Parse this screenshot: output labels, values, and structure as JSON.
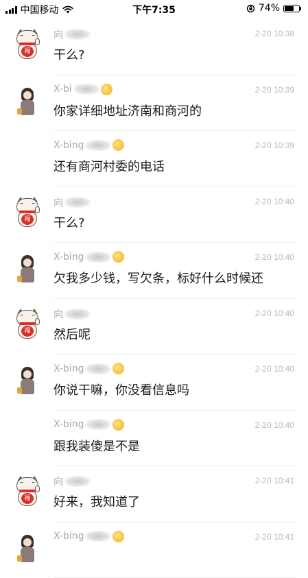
{
  "status_bar": {
    "carrier": "中国移动",
    "time": "下午7:35",
    "battery_percent": "74%",
    "battery_level": 0.74,
    "icons": [
      "signal-icon",
      "wifi-icon",
      "orientation-lock-icon",
      "battery-icon"
    ]
  },
  "messages": [
    {
      "avatar": "lucky-cat",
      "sender": "向",
      "sender_blurred": true,
      "sender_emoji": false,
      "time": "2-20 10:38",
      "text": "干么?"
    },
    {
      "avatar": "girl",
      "sender": "X-bi",
      "sender_blurred": true,
      "sender_emoji": true,
      "time": "2-20 10:39",
      "text": "你家详细地址济南和商河的"
    },
    {
      "avatar": "none",
      "sender": "X-bing",
      "sender_blurred": true,
      "sender_emoji": true,
      "time": "2-20 10:39",
      "text": "还有商河村委的电话"
    },
    {
      "avatar": "lucky-cat",
      "sender": "向",
      "sender_blurred": true,
      "sender_emoji": false,
      "time": "2-20 10:40",
      "text": "干么?"
    },
    {
      "avatar": "girl",
      "sender": "X-bing",
      "sender_blurred": true,
      "sender_emoji": true,
      "time": "2-20 10:40",
      "text": "欠我多少钱，写欠条，标好什么时候还"
    },
    {
      "avatar": "lucky-cat",
      "sender": "向",
      "sender_blurred": true,
      "sender_emoji": false,
      "time": "2-20 10:40",
      "text": "然后呢"
    },
    {
      "avatar": "girl",
      "sender": "X-bing",
      "sender_blurred": true,
      "sender_emoji": true,
      "time": "2-20 10:40",
      "text": "你说干嘛，你没看信息吗"
    },
    {
      "avatar": "none",
      "sender": "X-bing",
      "sender_blurred": true,
      "sender_emoji": true,
      "time": "2-20 10:40",
      "text": "跟我装傻是不是"
    },
    {
      "avatar": "lucky-cat",
      "sender": "向",
      "sender_blurred": true,
      "sender_emoji": false,
      "time": "2-20 10:41",
      "text": "好来，我知道了"
    },
    {
      "avatar": "girl",
      "sender": "X-bing",
      "sender_blurred": true,
      "sender_emoji": true,
      "time": "2-20 10:41",
      "text": ""
    }
  ],
  "cat_coin_char": "福"
}
